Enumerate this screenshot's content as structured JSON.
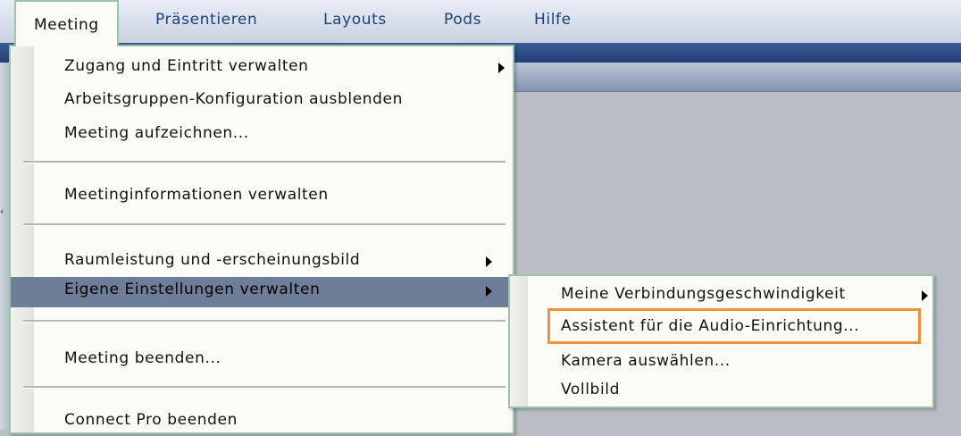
{
  "menubar": {
    "items": [
      "Meeting",
      "Präsentieren",
      "Layouts",
      "Pods",
      "Hilfe"
    ]
  },
  "meeting_menu": {
    "items": [
      {
        "label": "Zugang und Eintritt verwalten",
        "submenu": true
      },
      {
        "label": "Arbeitsgruppen-Konfiguration ausblenden",
        "submenu": false
      },
      {
        "label": "Meeting aufzeichnen...",
        "submenu": false
      },
      {
        "label": "Meetinginformationen verwalten",
        "submenu": false
      },
      {
        "label": "Raumleistung und -erscheinungsbild",
        "submenu": true
      },
      {
        "label": "Eigene Einstellungen verwalten",
        "submenu": true,
        "highlighted": true
      },
      {
        "label": "Meeting beenden...",
        "submenu": false
      },
      {
        "label": "Connect Pro beenden",
        "submenu": false
      }
    ]
  },
  "settings_submenu": {
    "items": [
      {
        "label": "Meine Verbindungsgeschwindigkeit",
        "submenu": true
      },
      {
        "label": "Assistent für die Audio-Einrichtung...",
        "submenu": false,
        "outlined": true
      },
      {
        "label": "Kamera auswählen...",
        "submenu": false
      },
      {
        "label": "Vollbild",
        "submenu": false
      }
    ]
  },
  "colors": {
    "menu_bg": "#fbfcf6",
    "menu_border": "#9cc4a8",
    "highlight": "#6f7e98",
    "focus_outline": "#f0913a",
    "menubar_text": "#1f3f77"
  },
  "icons": [
    "submenu-arrow-icon"
  ]
}
